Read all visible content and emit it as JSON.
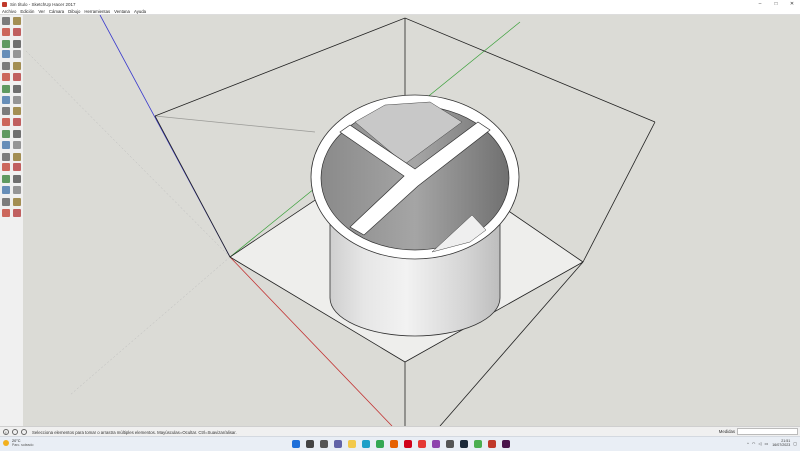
{
  "window": {
    "title": "Sin título - SketchUp Hacer 2017",
    "controls": {
      "minimize": "–",
      "maximize": "□",
      "close": "✕"
    }
  },
  "menu": [
    "Archivo",
    "Edición",
    "Ver",
    "Cámara",
    "Dibujo",
    "Herramientas",
    "Ventana",
    "Ayuda"
  ],
  "toolbar": {
    "tools": [
      "select-tool-icon",
      "component-tool-icon",
      "paint-bucket-icon",
      "eraser-icon",
      "line-tool-icon",
      "freehand-icon",
      "rectangle-tool-icon",
      "rotated-rectangle-icon",
      "circle-tool-icon",
      "polygon-tool-icon",
      "arc-tool-icon",
      "two-point-arc-icon",
      "three-point-arc-icon",
      "pie-icon",
      "move-tool-icon",
      "push-pull-icon",
      "rotate-tool-icon",
      "follow-me-icon",
      "scale-tool-icon",
      "offset-tool-icon",
      "tape-measure-icon",
      "dimension-icon",
      "protractor-icon",
      "text-tool-icon",
      "axes-tool-icon",
      "3d-text-icon",
      "orbit-tool-icon",
      "pan-tool-icon",
      "zoom-tool-icon",
      "zoom-window-icon",
      "zoom-extents-icon",
      "previous-view-icon",
      "position-camera-icon",
      "look-around-icon",
      "walk-tool-icon",
      "section-plane-icon"
    ]
  },
  "status": {
    "hint": "Selecciona elementos para tomar o arrastra múltiples elementos. Mayúsculas=Ocultar. Ctrl=Suavizar/alisar.",
    "measurements_label": "Medidas",
    "measurements_value": ""
  },
  "taskbar": {
    "weather_temp": "20°C",
    "weather_desc": "Parc. soleado",
    "apps": [
      {
        "name": "start-icon",
        "color": "#1e6fd9"
      },
      {
        "name": "search-icon",
        "color": "#444444"
      },
      {
        "name": "task-view-icon",
        "color": "#555555"
      },
      {
        "name": "chat-icon",
        "color": "#6264a7"
      },
      {
        "name": "explorer-icon",
        "color": "#f2c94c"
      },
      {
        "name": "edge-icon",
        "color": "#1fa0c8"
      },
      {
        "name": "chrome-icon",
        "color": "#34a853"
      },
      {
        "name": "firefox-icon",
        "color": "#e66000"
      },
      {
        "name": "opera-icon",
        "color": "#d0021b"
      },
      {
        "name": "youtube-icon",
        "color": "#e53935"
      },
      {
        "name": "vs-icon",
        "color": "#8e44ad"
      },
      {
        "name": "calculator-icon",
        "color": "#555555"
      },
      {
        "name": "steam-icon",
        "color": "#1b2838"
      },
      {
        "name": "chrome-2-icon",
        "color": "#4caf50"
      },
      {
        "name": "sketchup-icon",
        "color": "#c0392b"
      },
      {
        "name": "slack-icon",
        "color": "#4a154b"
      }
    ],
    "tray": {
      "caret": "^",
      "time": "21:51",
      "date": "16/07/2023"
    }
  }
}
